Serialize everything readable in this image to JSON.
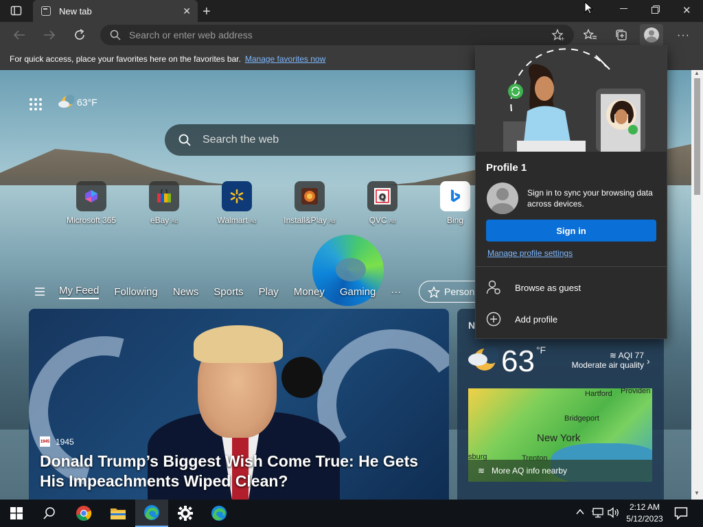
{
  "browser": {
    "tab_title": "New tab",
    "address_placeholder": "Search or enter web address",
    "favbar_text": "For quick access, place your favorites here on the favorites bar.",
    "favbar_link": "Manage favorites now"
  },
  "ntp": {
    "weather_temp": "63°F",
    "search_placeholder": "Search the web",
    "quick_links": [
      {
        "label": "Microsoft 365",
        "ad": ""
      },
      {
        "label": "eBay",
        "ad": "Ad"
      },
      {
        "label": "Walmart",
        "ad": "Ad"
      },
      {
        "label": "Install&Play",
        "ad": "Ad"
      },
      {
        "label": "QVC",
        "ad": "Ad"
      },
      {
        "label": "Bing",
        "ad": ""
      }
    ],
    "feed_tabs": [
      "My Feed",
      "Following",
      "News",
      "Sports",
      "Play",
      "Money",
      "Gaming"
    ],
    "more_label": "···",
    "personalize_label": "Person",
    "news": {
      "source": "1945",
      "title": "Donald Trump’s Biggest Wish Come True: He Gets His Impeachments Wiped Clean?"
    },
    "weather_card": {
      "header_letter": "N",
      "temp": "63",
      "unit": "°F",
      "aqi": "AQI 77",
      "aqi_desc": "Moderate air quality",
      "map_labels": [
        "Hartford",
        "Providen",
        "Bridgeport",
        "New York",
        "sburg",
        "Trenton"
      ],
      "map_footer": "More AQ info nearby"
    }
  },
  "profile_panel": {
    "name": "Profile 1",
    "sync_text": "Sign in to sync your browsing data across devices.",
    "signin_label": "Sign in",
    "manage_link": "Manage profile settings",
    "guest_label": "Browse as guest",
    "add_label": "Add profile"
  },
  "taskbar": {
    "time": "2:12 AM",
    "date": "5/12/2023"
  },
  "colors": {
    "accent": "#0a6fd6",
    "link": "#7fb9ff"
  }
}
